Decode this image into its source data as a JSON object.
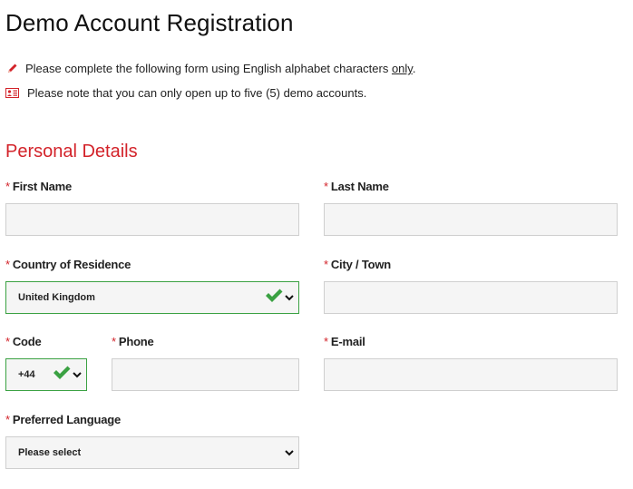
{
  "page": {
    "title": "Demo Account Registration"
  },
  "notes": [
    {
      "icon": "pencil-icon",
      "text_before": "Please complete the following form using English alphabet characters ",
      "underlined": "only",
      "text_after": "."
    },
    {
      "icon": "id-card-icon",
      "text": "Please note that you can only open up to five (5) demo accounts."
    }
  ],
  "section": {
    "title": "Personal Details"
  },
  "required_marker": "*",
  "fields": {
    "first_name": {
      "label": "First Name",
      "value": ""
    },
    "last_name": {
      "label": "Last Name",
      "value": ""
    },
    "country": {
      "label": "Country of Residence",
      "value": "United Kingdom",
      "valid": true
    },
    "city": {
      "label": "City / Town",
      "value": ""
    },
    "code": {
      "label": "Code",
      "value": "+44",
      "valid": true
    },
    "phone": {
      "label": "Phone",
      "value": ""
    },
    "email": {
      "label": "E-mail",
      "value": ""
    },
    "language": {
      "label": "Preferred Language",
      "value": "Please select"
    }
  },
  "colors": {
    "accent_red": "#d3232a",
    "valid_green": "#3aa142",
    "field_bg": "#f5f5f5",
    "field_border": "#cfcfcf"
  }
}
